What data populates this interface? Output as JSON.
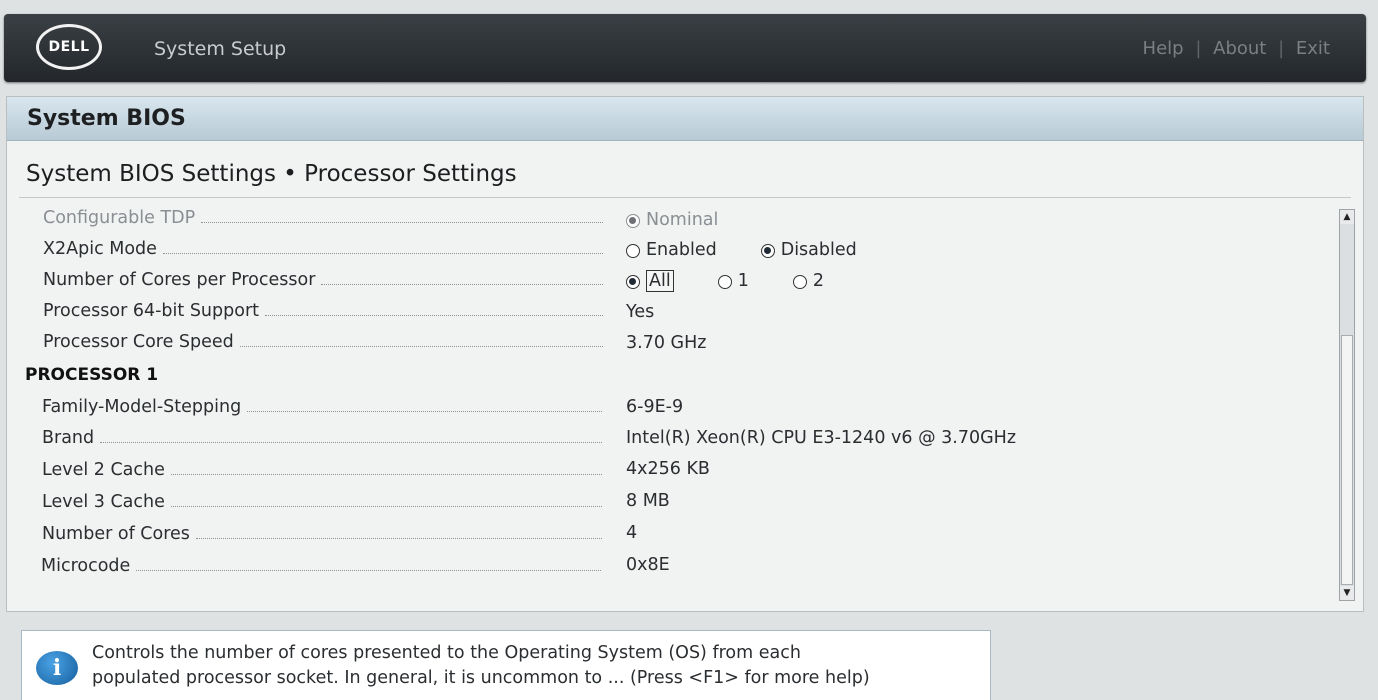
{
  "header": {
    "logo_text": "DELL",
    "app_title": "System Setup",
    "nav": {
      "help": "Help",
      "about": "About",
      "exit": "Exit",
      "separator": "|"
    }
  },
  "panel": {
    "title": "System BIOS",
    "subtitle": "System BIOS Settings • Processor Settings"
  },
  "settings": {
    "configurable_tdp": {
      "label": "Configurable TDP",
      "value": "Nominal"
    },
    "x2apic_mode": {
      "label": "X2Apic Mode",
      "options": [
        "Enabled",
        "Disabled"
      ],
      "selected": "Disabled"
    },
    "cores_per_processor": {
      "label": "Number of Cores per Processor",
      "options": [
        "All",
        "1",
        "2"
      ],
      "selected": "All"
    },
    "processor_64bit": {
      "label": "Processor 64-bit Support",
      "value": "Yes"
    },
    "core_speed": {
      "label": "Processor Core Speed",
      "value": "3.70 GHz"
    }
  },
  "processor1": {
    "heading": "PROCESSOR 1",
    "family_model_stepping": {
      "label": "Family-Model-Stepping",
      "value": "6-9E-9"
    },
    "brand": {
      "label": "Brand",
      "value": "Intel(R) Xeon(R) CPU E3-1240 v6 @ 3.70GHz"
    },
    "l2_cache": {
      "label": "Level 2 Cache",
      "value": "4x256 KB"
    },
    "l3_cache": {
      "label": "Level 3 Cache",
      "value": "8 MB"
    },
    "num_cores": {
      "label": "Number of Cores",
      "value": "4"
    },
    "microcode": {
      "label": "Microcode",
      "value": "0x8E"
    }
  },
  "help_box": {
    "line1": "Controls the number of cores presented to the Operating System (OS) from each",
    "line2": "populated processor socket. In general, it is uncommon to ... (Press <F1> for more help)"
  },
  "scrollbar": {
    "up_glyph": "▲",
    "down_glyph": "▼"
  }
}
